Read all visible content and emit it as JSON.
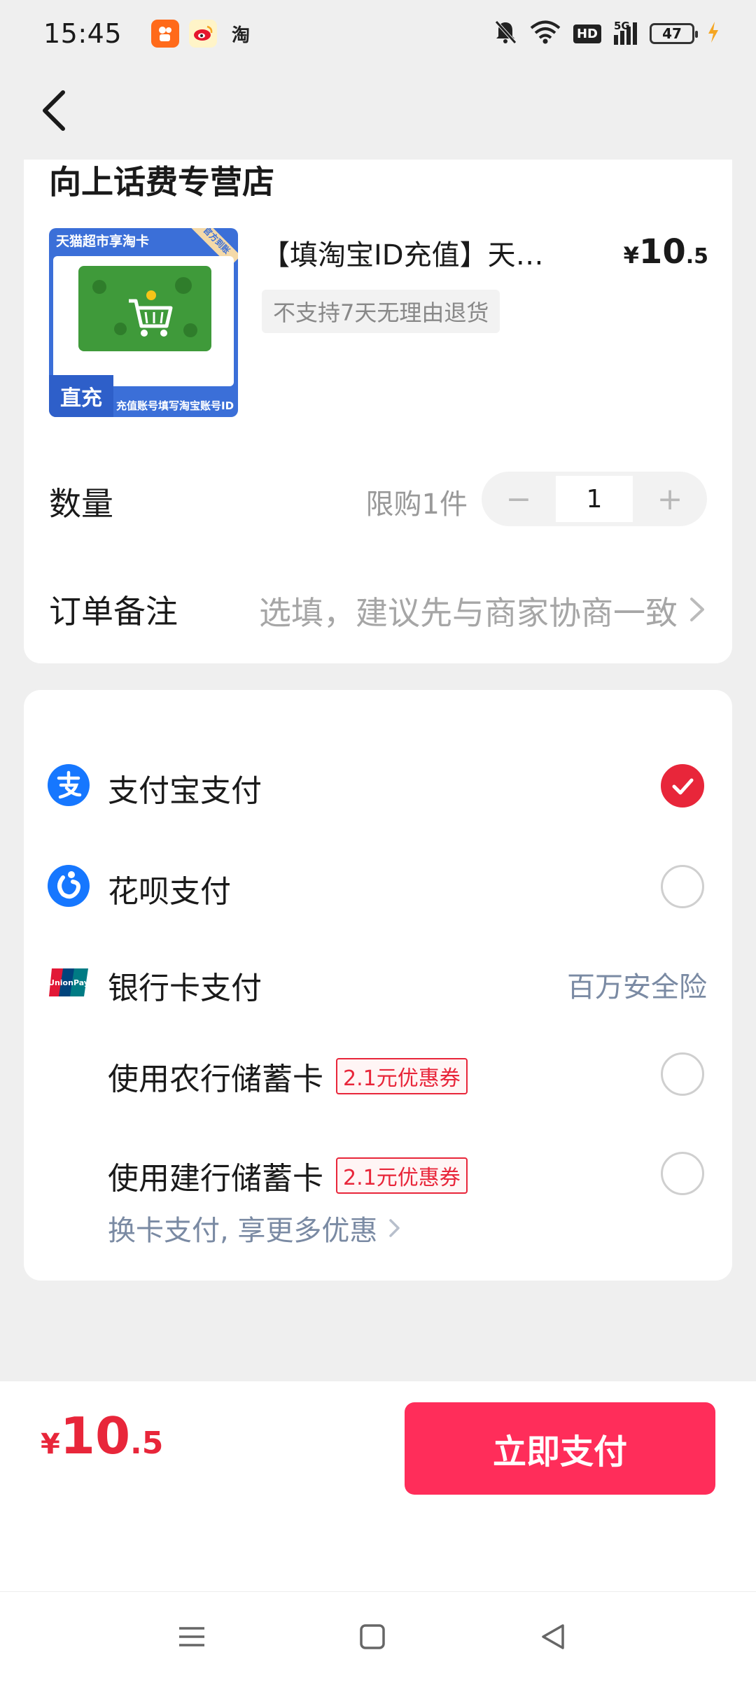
{
  "status_bar": {
    "time": "15:45",
    "app_icons": [
      "kuaishou-icon",
      "weibo-icon",
      "taobao-icon"
    ],
    "taobao_text": "淘",
    "hd": "HD",
    "network": "5G",
    "battery": "47"
  },
  "nav": {
    "back_icon": "back-arrow-icon"
  },
  "order": {
    "shop_name": "向上话费专营店",
    "product": {
      "image_banner": "天猫超市享淘卡",
      "image_ribbon": "官方到账",
      "image_badge": "直充",
      "image_bottom_text": "充值账号填写淘宝账号ID",
      "title": "【填淘宝ID充值】天猫超市享淘卡",
      "price_currency": "¥",
      "price_int": "10",
      "price_dec": ".5",
      "refund_tag": "不支持7天无理由退货"
    },
    "quantity": {
      "label": "数量",
      "limit": "限购1件",
      "value": "1",
      "minus": "−",
      "plus": "+"
    },
    "note": {
      "label": "订单备注",
      "placeholder": "选填，建议先与商家协商一致"
    }
  },
  "payment": {
    "alipay": {
      "label": "支付宝支付",
      "selected": true
    },
    "huabei": {
      "label": "花呗支付",
      "selected": false
    },
    "bankcard": {
      "label": "银行卡支付",
      "safety": "百万安全险",
      "options": [
        {
          "label": "使用农行储蓄卡",
          "coupon": "2.1元优惠券"
        },
        {
          "label": "使用建行储蓄卡",
          "coupon": "2.1元优惠券"
        }
      ]
    },
    "more_cards": "换卡支付, 享更多优惠"
  },
  "footer": {
    "total_currency": "¥",
    "total_int": "10",
    "total_dec": ".5",
    "pay_button": "立即支付"
  },
  "colors": {
    "accent_red": "#e8263a",
    "pay_button": "#ff2d5a",
    "alipay_blue": "#1677ff"
  }
}
